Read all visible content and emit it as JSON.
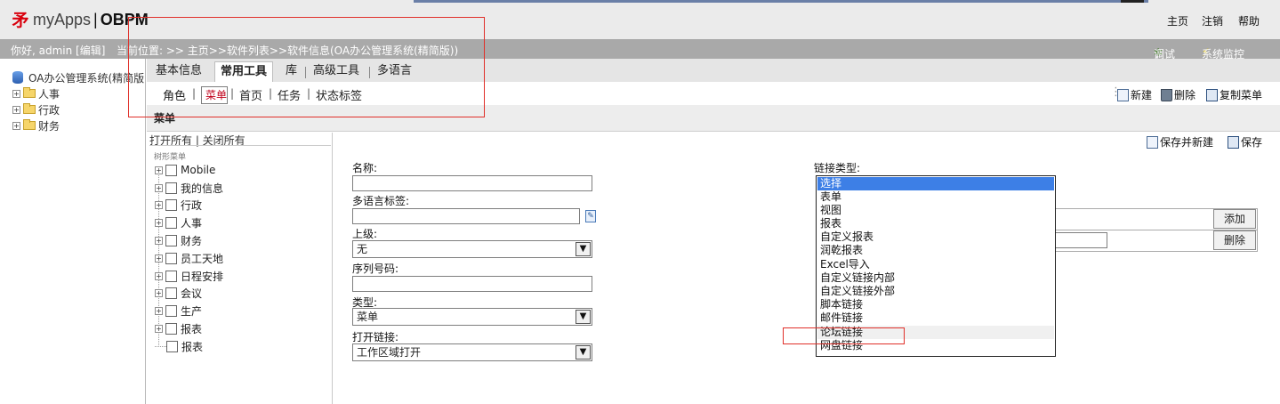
{
  "header": {
    "logo_mark": "矛",
    "logo_prefix": "myApps",
    "logo_suffix": "OBPM",
    "links": [
      "主页",
      "注销",
      "帮助"
    ]
  },
  "infobar": {
    "greeting": "你好, admin [编辑]",
    "breadcrumb": "当前位置: >> 主页>>软件列表>>软件信息(OA办公管理系统(精简版))",
    "debug": "调试",
    "monitor": "系统监控"
  },
  "left_tree": {
    "root": "OA办公管理系统(精简版",
    "items": [
      "人事",
      "行政",
      "财务"
    ]
  },
  "tabs": [
    "基本信息",
    "常用工具",
    "库",
    "高级工具",
    "多语言"
  ],
  "subnav": [
    "角色",
    "菜单",
    "首页",
    "任务",
    "状态标签"
  ],
  "toolbar": {
    "new": "新建",
    "delete": "删除",
    "copy": "复制菜单"
  },
  "section_title": "菜单",
  "menu_tree": {
    "toolbar": "打开所有 | 关闭所有",
    "caption": "树形菜单",
    "nodes": [
      "Mobile",
      "我的信息",
      "行政",
      "人事",
      "财务",
      "员工天地",
      "日程安排",
      "会议",
      "生产",
      "报表",
      "报表"
    ]
  },
  "form": {
    "save_new": "保存并新建",
    "save": "保存",
    "name_label": "名称:",
    "i18n_label": "多语言标签:",
    "parent_label": "上级:",
    "parent_value": "无",
    "order_label": "序列号码:",
    "type_label": "类型:",
    "type_value": "菜单",
    "open_label": "打开链接:",
    "open_value": "工作区域打开",
    "link_type_label": "链接类型:",
    "add_button": "添加",
    "delete_button": "删除"
  },
  "link_options": [
    "选择",
    "表单",
    "视图",
    "报表",
    "自定义报表",
    "润乾报表",
    "Excel导入",
    "自定义链接内部",
    "自定义链接外部",
    "脚本链接",
    "邮件链接",
    "论坛链接",
    "网盘链接"
  ],
  "colors": {
    "selected_option": "#3d7fe6",
    "annotation_red": "#e0302a",
    "infobar": "#a9a9a9"
  }
}
